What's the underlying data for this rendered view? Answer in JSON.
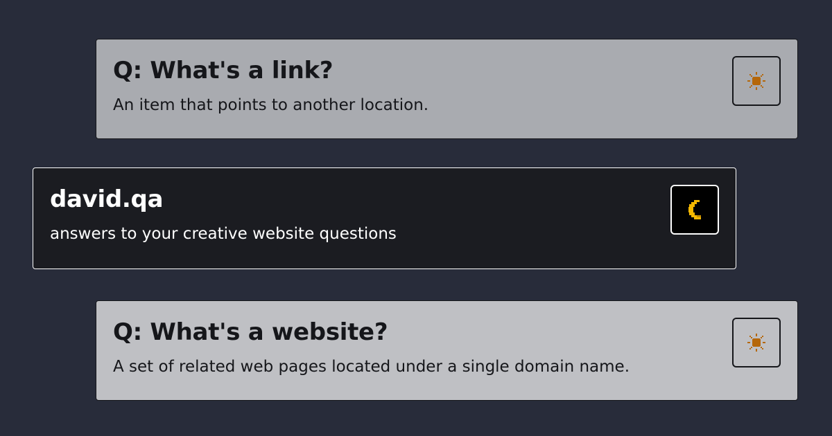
{
  "cards": [
    {
      "title": "Q: What's a link?",
      "text": "An item that points to another location.",
      "toggle_icon": "sun-icon"
    },
    {
      "title": "david.qa",
      "text": "answers to your creative website questions",
      "toggle_icon": "moon-icon"
    },
    {
      "title": "Q: What's a website?",
      "text": "A set of related web pages located under a single domain name.",
      "toggle_icon": "sun-icon"
    }
  ],
  "colors": {
    "background": "#282c3a",
    "card_light_top": "#a9abb0",
    "card_light_bottom": "#bfc0c4",
    "card_dark": "#1b1c21",
    "sun": "#b5670a",
    "moon": "#f5b800"
  }
}
